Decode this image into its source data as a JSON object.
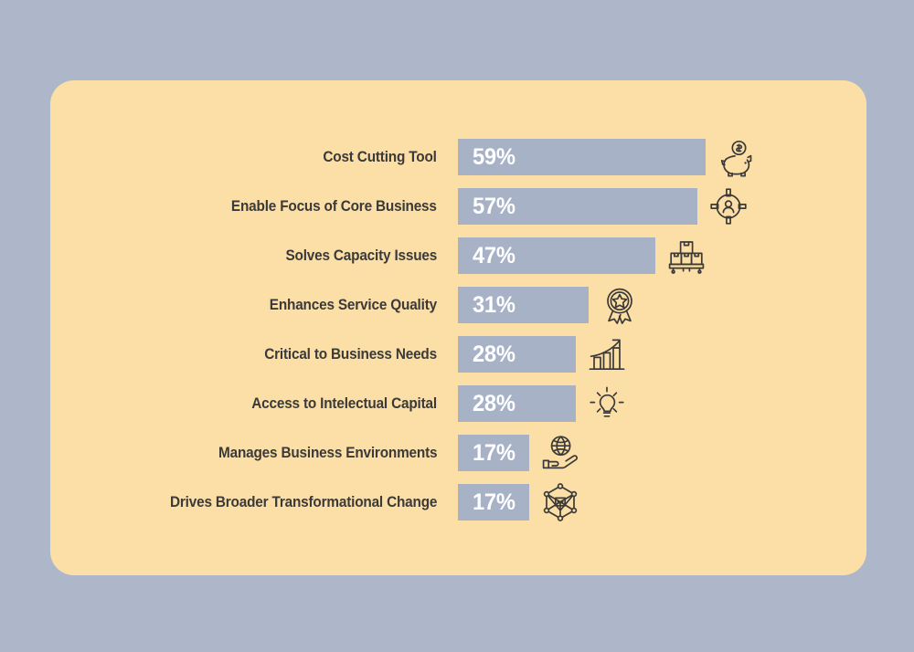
{
  "theme": {
    "page_background": "#aeb7c9",
    "card_background": "#fcdfa6",
    "bar_color": "#a7b2c7",
    "label_color": "#3b3a38",
    "value_color": "#ffffff",
    "icon_color": "#3b3a38"
  },
  "chart_data": {
    "type": "bar",
    "orientation": "horizontal",
    "title": "",
    "subtitle": "",
    "xlabel": "",
    "ylabel": "",
    "xlim": [
      0,
      100
    ],
    "grid": false,
    "legend": null,
    "value_suffix": "%",
    "categories": [
      "Cost Cutting Tool",
      "Enable Focus of Core Business",
      "Solves Capacity Issues",
      "Enhances Service Quality",
      "Critical to Business Needs",
      "Access to Intelectual Capital",
      "Manages Business Environments",
      "Drives Broader Transformational Change"
    ],
    "values": [
      59,
      57,
      47,
      31,
      28,
      28,
      17,
      17
    ],
    "value_labels": [
      "59%",
      "57%",
      "47%",
      "31%",
      "28%",
      "28%",
      "17%",
      "17%"
    ],
    "icons": [
      "piggy-bank-icon",
      "target-person-icon",
      "stacked-boxes-icon",
      "award-medal-icon",
      "growth-chart-icon",
      "lightbulb-icon",
      "globe-in-hand-icon",
      "cube-network-icon"
    ]
  }
}
